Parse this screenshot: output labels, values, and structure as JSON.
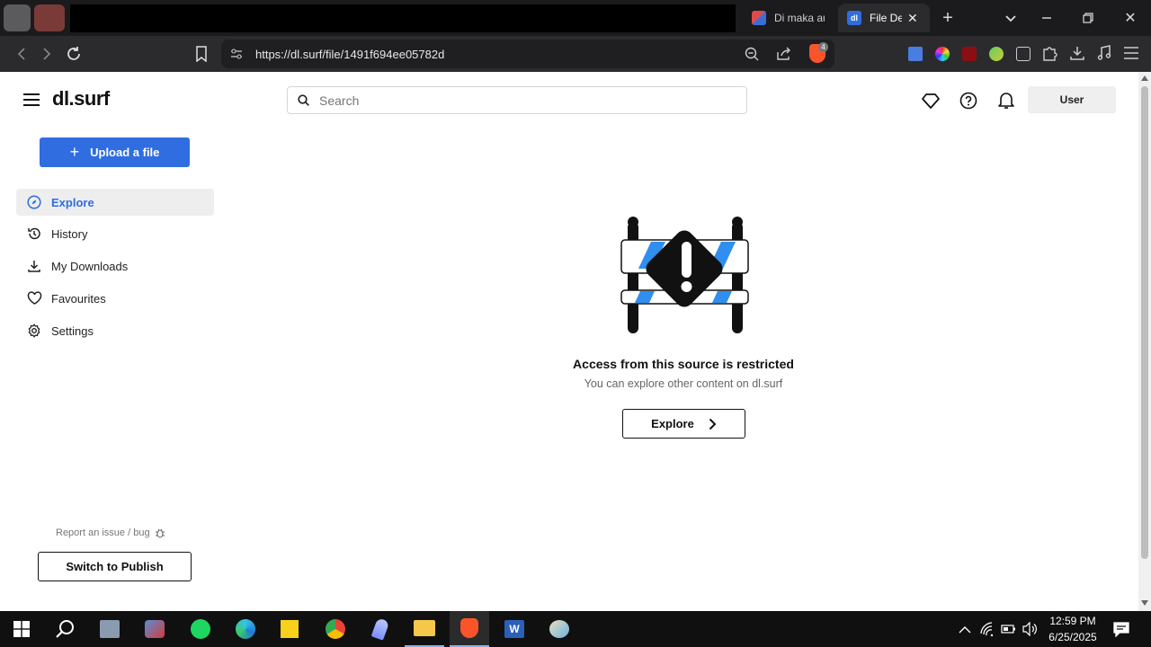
{
  "browser": {
    "tabs": [
      {
        "title": "Di maka au"
      },
      {
        "title": "File De",
        "favicon_text": "dl"
      }
    ],
    "url": "https://dl.surf/file/1491f694ee05782d",
    "shields_count": "4"
  },
  "site": {
    "logo": "dl.surf",
    "search_placeholder": "Search",
    "user_label": "User",
    "upload_label": "Upload a file",
    "nav": [
      {
        "label": "Explore",
        "icon": "compass-icon",
        "active": true
      },
      {
        "label": "History",
        "icon": "history-icon"
      },
      {
        "label": "My Downloads",
        "icon": "download-icon"
      },
      {
        "label": "Favourites",
        "icon": "heart-icon"
      },
      {
        "label": "Settings",
        "icon": "gear-icon"
      }
    ],
    "report_label": "Report an issue / bug",
    "switch_label": "Switch to Publish",
    "accent": "#2f6de1"
  },
  "main": {
    "message_title": "Access from this source is restricted",
    "message_sub": "You can explore other content on dl.surf",
    "explore_button": "Explore"
  },
  "taskbar": {
    "time": "12:59 PM",
    "date": "6/25/2025"
  }
}
